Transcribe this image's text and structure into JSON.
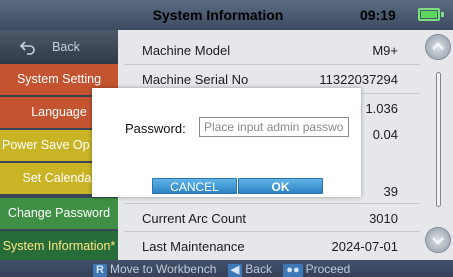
{
  "header": {
    "title": "System Information",
    "clock": "09:19",
    "battery_color": "#5bd85b"
  },
  "sidebar": {
    "back": "Back",
    "items": [
      {
        "label": "System Setting"
      },
      {
        "label": "Language"
      },
      {
        "label": "Power Save Op"
      },
      {
        "label": "Set Calendar"
      },
      {
        "label": "Change Password"
      },
      {
        "label": "System Information*"
      }
    ]
  },
  "info": {
    "rows": [
      {
        "key": "Machine Model",
        "value": "M9+"
      },
      {
        "key": "Machine Serial No",
        "value": "11322037294"
      },
      {
        "key": "",
        "value": "1.036"
      },
      {
        "key": "",
        "value": "0.04"
      },
      {
        "key": "",
        "value": ""
      },
      {
        "key": "",
        "value": "39"
      },
      {
        "key": "Current Arc Count",
        "value": "3010"
      },
      {
        "key": "Last Maintenance",
        "value": "2024-07-01"
      }
    ]
  },
  "dialog": {
    "label": "Password:",
    "placeholder": "Place input admin password",
    "cancel": "CANCEL",
    "ok": "OK"
  },
  "bottom": {
    "key1": "R",
    "text1": "Move to Workbench",
    "key2": "",
    "text2": "Back",
    "key3": "",
    "text3": "Proceed"
  }
}
